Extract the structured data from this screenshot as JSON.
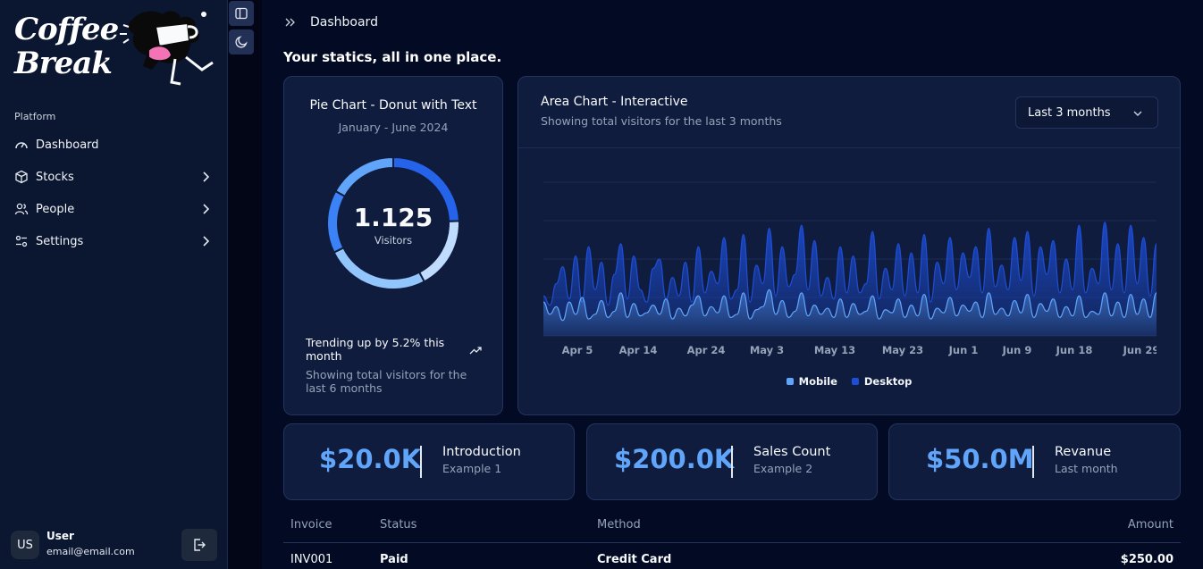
{
  "brand": {
    "line1": "Coffee",
    "line2": "Break"
  },
  "sidebar": {
    "section_label": "Platform",
    "items": [
      {
        "label": "Dashboard",
        "icon": "gauge-icon"
      },
      {
        "label": "Stocks",
        "icon": "box-icon"
      },
      {
        "label": "People",
        "icon": "users-icon"
      },
      {
        "label": "Settings",
        "icon": "sliders-icon"
      }
    ],
    "user": {
      "initials": "US",
      "name": "User",
      "email": "email@email.com"
    }
  },
  "header": {
    "breadcrumb": "Dashboard",
    "title": "Your statics, all in one place."
  },
  "pie_card": {
    "title": "Pie Chart - Donut with Text",
    "subtitle": "January - June 2024",
    "total": "1.125",
    "total_label": "Visitors",
    "trend": "Trending up by 5.2% this month",
    "footer": "Showing total visitors for the last 6 months"
  },
  "area_card": {
    "title": "Area Chart - Interactive",
    "subtitle": "Showing total visitors for the last 3 months",
    "range_selected": "Last 3 months"
  },
  "stats": [
    {
      "value": "$20.0K",
      "label": "Introduction",
      "sub": "Example 1"
    },
    {
      "value": "$200.0K",
      "label": "Sales Count",
      "sub": "Example 2"
    },
    {
      "value": "$50.0M",
      "label": "Revanue",
      "sub": "Last month"
    }
  ],
  "table": {
    "headers": [
      "Invoice",
      "Status",
      "Method",
      "Amount"
    ],
    "rows": [
      [
        "INV001",
        "Paid",
        "Credit Card",
        "$250.00"
      ]
    ]
  },
  "chart_data": [
    {
      "type": "pie",
      "title": "Pie Chart - Donut with Text",
      "subtitle": "January - June 2024",
      "center_value": "1.125",
      "center_label": "Visitors",
      "slices": [
        {
          "value": 275,
          "color": "#2563eb"
        },
        {
          "value": 200,
          "color": "#bfdbfe"
        },
        {
          "value": 287,
          "color": "#93c5fd"
        },
        {
          "value": 173,
          "color": "#3b82f6"
        },
        {
          "value": 190,
          "color": "#60a5fa"
        }
      ]
    },
    {
      "type": "area",
      "title": "Area Chart - Interactive",
      "x_ticks": [
        "Apr 5",
        "Apr 14",
        "Apr 24",
        "May 3",
        "May 13",
        "May 23",
        "Jun 1",
        "Jun 9",
        "Jun 18",
        "Jun 29"
      ],
      "ylim": [
        0,
        100
      ],
      "grid": true,
      "legend_position": "bottom",
      "series": [
        {
          "name": "Mobile",
          "color": "#60a5fa",
          "values": [
            22,
            14,
            19,
            10,
            22,
            14,
            25,
            11,
            14,
            23,
            12,
            16,
            28,
            12,
            21,
            13,
            15,
            20,
            14,
            24,
            11,
            18,
            13,
            20,
            26,
            13,
            19,
            15,
            26,
            12,
            14,
            28,
            11,
            17,
            19,
            30,
            14,
            23,
            12,
            16,
            28,
            13,
            20,
            14,
            18,
            12,
            24,
            12,
            21,
            14,
            16,
            26,
            11,
            17,
            15,
            24,
            12,
            20,
            13,
            27,
            11,
            18,
            15,
            25,
            13,
            20,
            16,
            22,
            12,
            28,
            14,
            18,
            13,
            23,
            15,
            27,
            12,
            21,
            16,
            24,
            12,
            19,
            13,
            26,
            12,
            16,
            14,
            28,
            13,
            22,
            12,
            27,
            14,
            24,
            12,
            28
          ]
        },
        {
          "name": "Desktop",
          "color": "#1d4ed8",
          "values": [
            26,
            20,
            34,
            45,
            24,
            52,
            22,
            58,
            30,
            48,
            20,
            40,
            60,
            24,
            52,
            30,
            22,
            44,
            50,
            24,
            38,
            26,
            48,
            22,
            58,
            28,
            42,
            34,
            64,
            24,
            30,
            66,
            22,
            46,
            34,
            70,
            26,
            58,
            32,
            40,
            72,
            30,
            62,
            26,
            38,
            24,
            58,
            28,
            52,
            28,
            34,
            68,
            24,
            44,
            30,
            60,
            26,
            54,
            28,
            66,
            22,
            48,
            34,
            64,
            30,
            54,
            38,
            58,
            28,
            70,
            32,
            46,
            30,
            64,
            36,
            68,
            26,
            58,
            40,
            62,
            28,
            50,
            30,
            72,
            28,
            44,
            34,
            74,
            30,
            60,
            28,
            72,
            34,
            64,
            26,
            60
          ]
        }
      ]
    }
  ]
}
